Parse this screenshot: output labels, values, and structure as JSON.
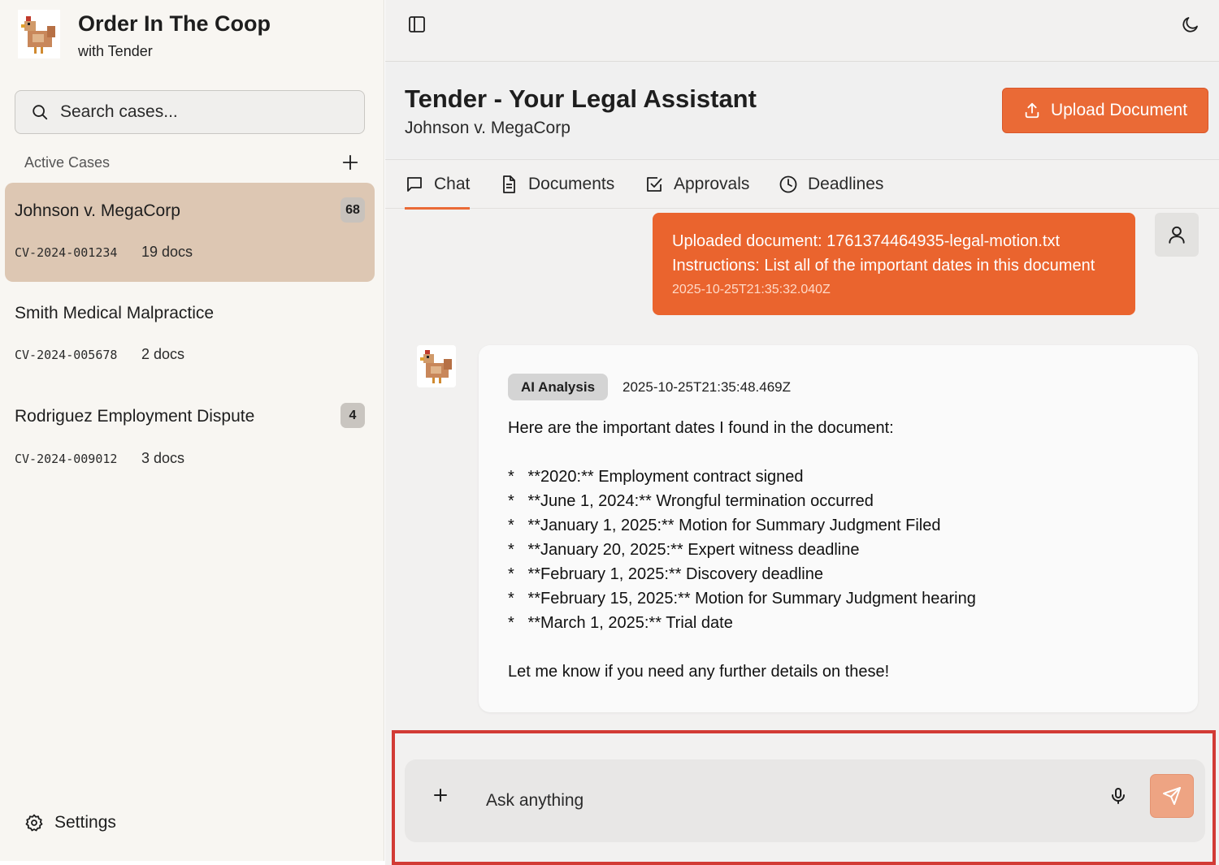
{
  "app": {
    "title": "Order In The Coop",
    "subtitle": "with Tender"
  },
  "sidebar": {
    "search_placeholder": "Search cases...",
    "section_label": "Active Cases",
    "cases": [
      {
        "name": "Johnson v. MegaCorp",
        "id": "CV-2024-001234",
        "docs": "19 docs",
        "badge": "68",
        "active": true
      },
      {
        "name": "Smith Medical Malpractice",
        "id": "CV-2024-005678",
        "docs": "2 docs",
        "badge": "",
        "active": false
      },
      {
        "name": "Rodriguez Employment Dispute",
        "id": "CV-2024-009012",
        "docs": "3 docs",
        "badge": "4",
        "active": false
      }
    ],
    "settings_label": "Settings"
  },
  "header": {
    "title": "Tender - Your Legal Assistant",
    "case_name": "Johnson v. MegaCorp",
    "upload_label": "Upload Document"
  },
  "tabs": [
    {
      "label": "Chat",
      "active": true,
      "icon": "chat-icon"
    },
    {
      "label": "Documents",
      "active": false,
      "icon": "document-icon"
    },
    {
      "label": "Approvals",
      "active": false,
      "icon": "checkbox-icon"
    },
    {
      "label": "Deadlines",
      "active": false,
      "icon": "clock-icon"
    }
  ],
  "messages": {
    "user": {
      "lines": [
        "Uploaded document: 1761374464935-legal-motion.txt",
        "Instructions: List all of the important dates in this document"
      ],
      "timestamp": "2025-10-25T21:35:32.040Z"
    },
    "assistant": {
      "badge": "AI Analysis",
      "timestamp": "2025-10-25T21:35:48.469Z",
      "body": "Here are the important dates I found in the document:\n\n*   **2020:** Employment contract signed\n*   **June 1, 2024:** Wrongful termination occurred\n*   **January 1, 2025:** Motion for Summary Judgment Filed\n*   **January 20, 2025:** Expert witness deadline\n*   **February 1, 2025:** Discovery deadline\n*   **February 15, 2025:** Motion for Summary Judgment hearing\n*   **March 1, 2025:** Trial date\n\nLet me know if you need any further details on these!"
    }
  },
  "composer": {
    "placeholder": "Ask anything"
  },
  "colors": {
    "accent": "#ea6a36",
    "active_case": "#ddc7b3",
    "highlight_frame": "#d23b35"
  }
}
